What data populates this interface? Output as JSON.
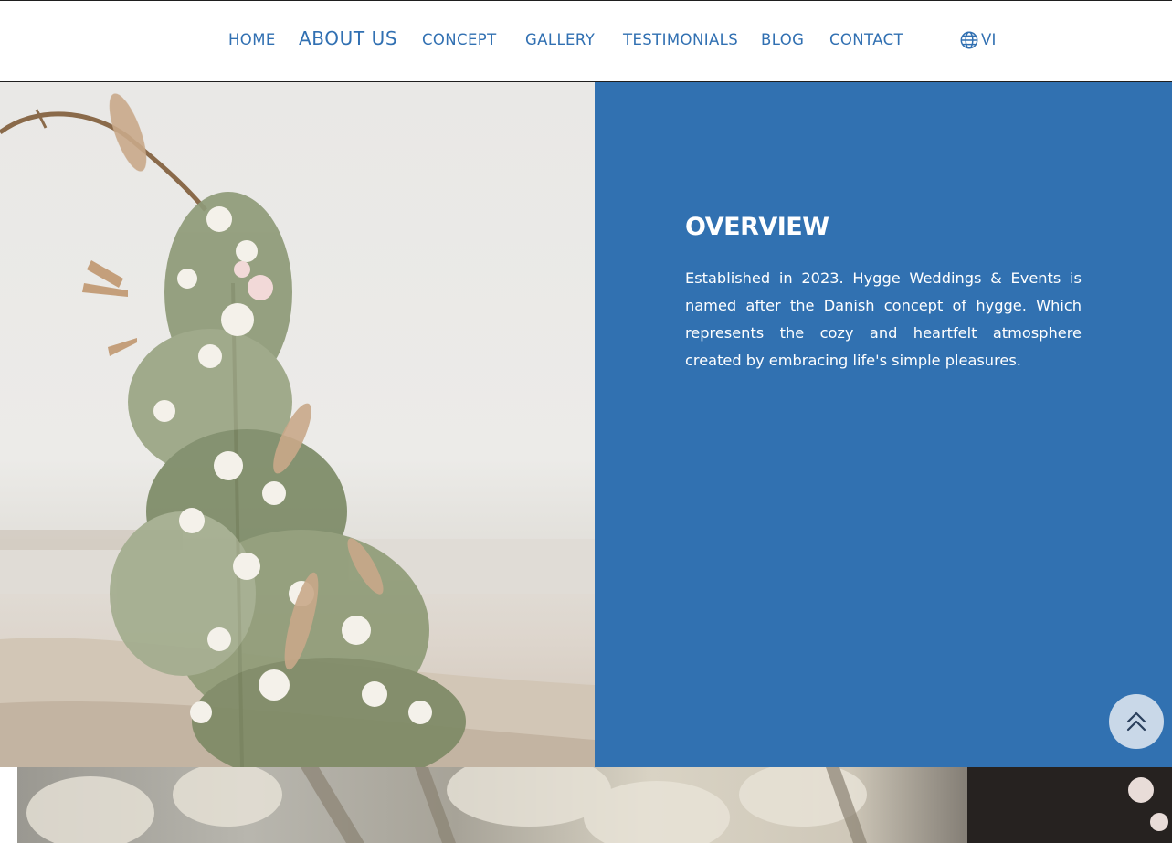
{
  "nav": {
    "items": [
      {
        "label": "HOME",
        "active": false
      },
      {
        "label": "ABOUT US",
        "active": true
      },
      {
        "label": "CONCEPT",
        "active": false
      },
      {
        "label": "GALLERY",
        "active": false
      },
      {
        "label": "TESTIMONIALS",
        "active": false
      },
      {
        "label": "BLOG",
        "active": false
      },
      {
        "label": "CONTACT",
        "active": false
      }
    ],
    "language": {
      "label": "VI",
      "icon": "globe-icon"
    }
  },
  "hero": {
    "image": "floral-arch-beach-photo",
    "title": "OVERVIEW",
    "text": "Established in 2023. Hygge Weddings & Events is named after the Danish concept of hygge. Which represents the cozy and heartfelt atmosphere created by embracing life's simple pleasures."
  },
  "scroll_top": {
    "icon": "chevrons-up-icon"
  },
  "next_section": {
    "image": "wedding-floral-decor-photo"
  },
  "colors": {
    "brand_blue": "#3171b1",
    "nav_text": "#3170b2",
    "scroll_button": "#c9d8e8",
    "white": "#ffffff"
  }
}
